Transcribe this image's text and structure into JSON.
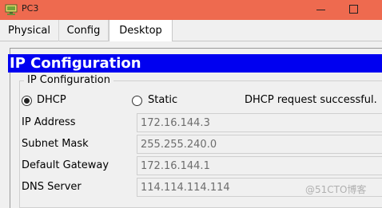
{
  "window": {
    "title": "PC3",
    "app_icon": "packet-tracer-pc-icon",
    "controls": [
      "minimize-icon",
      "maximize-icon"
    ]
  },
  "tabs": [
    {
      "label": "Physical",
      "active": false
    },
    {
      "label": "Config",
      "active": false
    },
    {
      "label": "Desktop",
      "active": true
    }
  ],
  "ip_config": {
    "header": "IP Configuration",
    "group_label": "IP Configuration",
    "mode": {
      "dhcp_label": "DHCP",
      "static_label": "Static",
      "selected": "DHCP"
    },
    "status": "DHCP request successful.",
    "fields": [
      {
        "label": "IP Address",
        "value": "172.16.144.3"
      },
      {
        "label": "Subnet Mask",
        "value": "255.255.240.0"
      },
      {
        "label": "Default Gateway",
        "value": "172.16.144.1"
      },
      {
        "label": "DNS Server",
        "value": "114.114.114.114"
      }
    ]
  },
  "watermark": "@51CTO博客",
  "colors": {
    "titlebar": "#ee6a4f",
    "header_bar": "#0000f0",
    "header_text": "#ffffff"
  }
}
